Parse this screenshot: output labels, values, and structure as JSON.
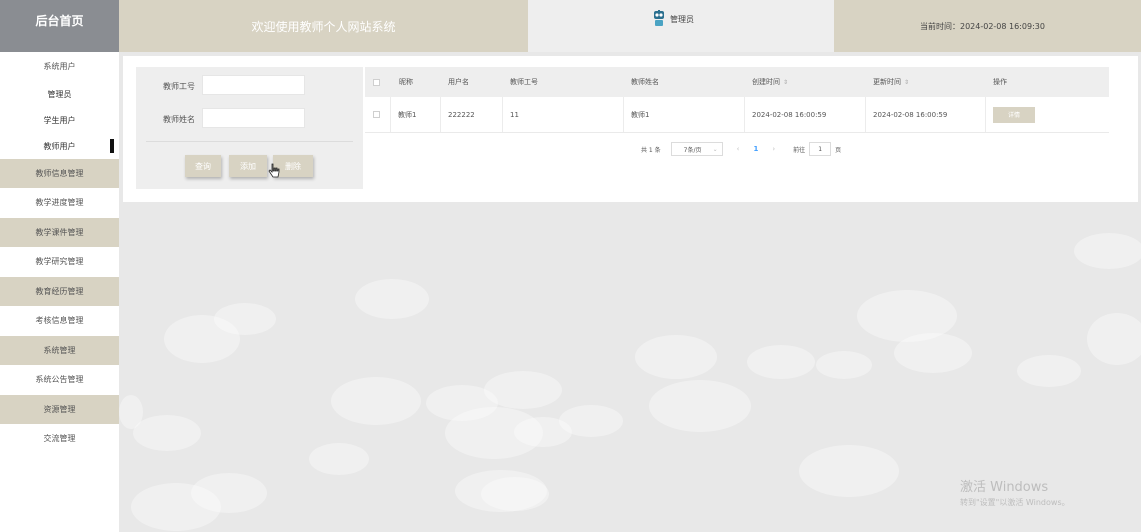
{
  "header": {
    "home_label": "后台首页",
    "welcome_text": "欢迎使用教师个人网站系统",
    "user_role": "管理员",
    "time_label": "当前时间：2024-02-08 16:09:30"
  },
  "sidebar": {
    "items": [
      {
        "label": "系统用户",
        "style": "white"
      },
      {
        "label": "管理员",
        "style": "sub"
      },
      {
        "label": "学生用户",
        "style": "sub"
      },
      {
        "label": "教师用户",
        "style": "sub-active"
      },
      {
        "label": "教师信息管理",
        "style": "tan"
      },
      {
        "label": "教学进度管理",
        "style": "white"
      },
      {
        "label": "教学课件管理",
        "style": "tan"
      },
      {
        "label": "教学研究管理",
        "style": "white"
      },
      {
        "label": "教育经历管理",
        "style": "tan"
      },
      {
        "label": "考核信息管理",
        "style": "white"
      },
      {
        "label": "系统管理",
        "style": "tan"
      },
      {
        "label": "系统公告管理",
        "style": "white"
      },
      {
        "label": "资源管理",
        "style": "tan"
      },
      {
        "label": "交流管理",
        "style": "white"
      }
    ]
  },
  "search": {
    "teacher_id_label": "教师工号",
    "teacher_name_label": "教师姓名",
    "teacher_id_value": "",
    "teacher_name_value": "",
    "query_button": "查询",
    "add_button": "添加",
    "delete_button": "删除"
  },
  "table": {
    "columns": [
      "昵称",
      "用户名",
      "教师工号",
      "教师姓名",
      "创建时间",
      "更新时间",
      "操作"
    ],
    "sort_icon": "⇕",
    "rows": [
      {
        "nickname": "教师1",
        "username": "222222",
        "teacher_id": "11",
        "teacher_name": "教师1",
        "created": "2024-02-08 16:00:59",
        "updated": "2024-02-08 16:00:59",
        "action": "详情"
      }
    ]
  },
  "pagination": {
    "total": "共 1 条",
    "page_size": "7条/页",
    "prev": "‹",
    "current": "1",
    "next": "›",
    "goto_label": "前往",
    "goto_value": "1",
    "page_unit": "页"
  },
  "watermark": {
    "title": "激活 Windows",
    "subtitle": "转到\"设置\"以激活 Windows。"
  },
  "colors": {
    "accent_tan": "#d8d3c3",
    "home_gray": "#8a8d92",
    "page_active": "#409eff"
  }
}
